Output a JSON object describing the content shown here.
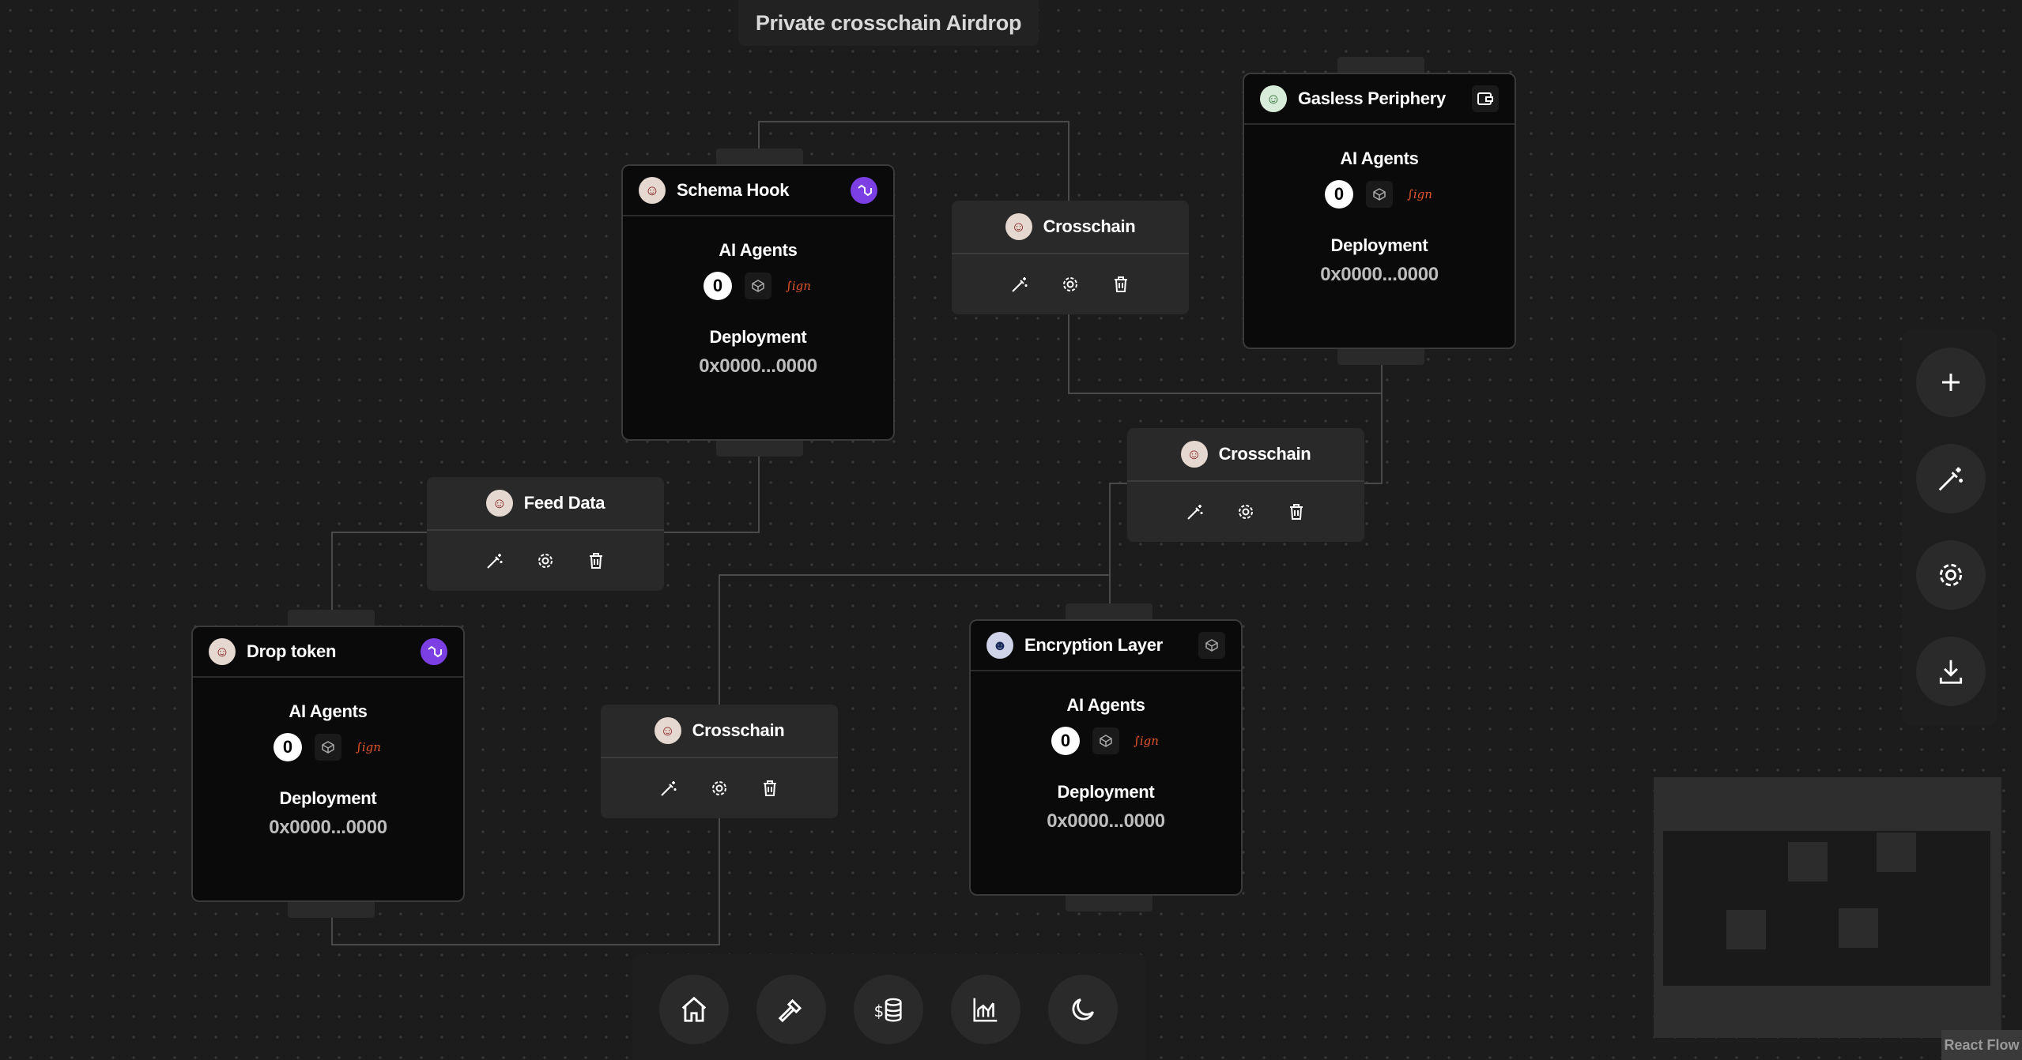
{
  "title": "Private crosschain Airdrop",
  "nodes": {
    "schema_hook": {
      "name": "Schema Hook",
      "agents_label": "AI Agents",
      "deploy_label": "Deployment",
      "address": "0x0000...0000"
    },
    "gasless": {
      "name": "Gasless Periphery",
      "agents_label": "AI Agents",
      "deploy_label": "Deployment",
      "address": "0x0000...0000"
    },
    "drop_token": {
      "name": "Drop token",
      "agents_label": "AI Agents",
      "deploy_label": "Deployment",
      "address": "0x0000...0000"
    },
    "encryption": {
      "name": "Encryption Layer",
      "agents_label": "AI Agents",
      "deploy_label": "Deployment",
      "address": "0x0000...0000"
    }
  },
  "tools": {
    "crosschain_1": {
      "name": "Crosschain"
    },
    "crosschain_2": {
      "name": "Crosschain"
    },
    "crosschain_3": {
      "name": "Crosschain"
    },
    "feed_data": {
      "name": "Feed Data"
    }
  },
  "icons": {
    "node_badge": "polygon-icon",
    "agent_icons": [
      "zero-icon",
      "box-icon",
      "signature-icon"
    ],
    "tool_actions": [
      "magic-wand-icon",
      "gear-icon",
      "trash-icon"
    ],
    "side_controls": [
      "plus-icon",
      "magic-wand-icon",
      "gear-icon",
      "download-icon"
    ],
    "dock": [
      "home-icon",
      "hammer-icon",
      "coin-database-icon",
      "chart-icon",
      "moon-icon"
    ]
  },
  "attribution": "React Flow",
  "colors": {
    "background": "#1c1c1c",
    "node": "#0a0a0a",
    "accent": "#7b3fe4",
    "signature": "#e0552a"
  }
}
